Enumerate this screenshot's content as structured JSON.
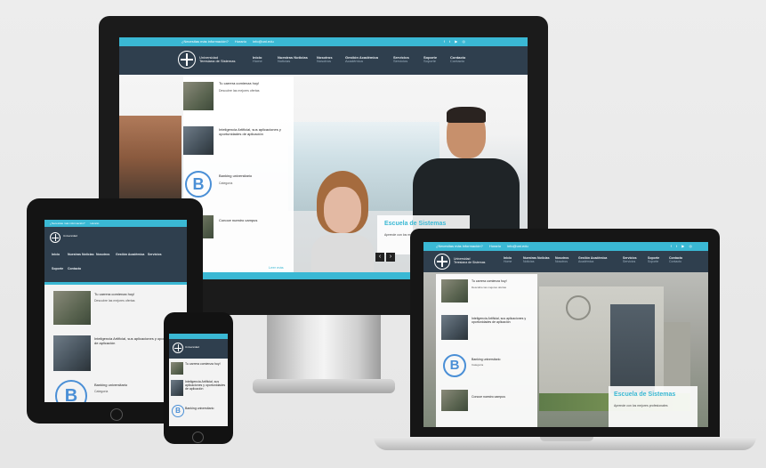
{
  "site": {
    "topbar": {
      "phone": "¿Necesitas más información?",
      "hours": "Horario",
      "email": "info@uni.edu"
    },
    "social_icons": [
      "facebook-icon",
      "twitter-icon",
      "youtube-icon",
      "instagram-icon"
    ],
    "logo_text": {
      "line1": "Universidad",
      "line2": "Teresiana de Sistemas"
    },
    "nav": [
      {
        "label": "Inicio",
        "sub": "Home"
      },
      {
        "label": "Nuestras Noticias",
        "sub": "Noticias"
      },
      {
        "label": "Nosotros",
        "sub": "Nosotros"
      },
      {
        "label": "Gestión Académica",
        "sub": "Académica"
      },
      {
        "label": "Servicios",
        "sub": "Servicios"
      },
      {
        "label": "Soporte",
        "sub": "Soporte"
      },
      {
        "label": "Contacto",
        "sub": "Contacto"
      }
    ],
    "posts": [
      {
        "title": "Tu carrera comienza hoy!",
        "meta": "Descubre las mejores ofertas"
      },
      {
        "title": "Inteligencia Artificial, sus aplicaciones y oportunidades de aplicación",
        "meta": ""
      },
      {
        "title": "Banking universitario",
        "meta": "Categoría"
      },
      {
        "title": "Conoce nuestro campus",
        "meta": ""
      }
    ],
    "hero_card": {
      "title": "Escuela de Sistemas",
      "text": "Aprende con los mejores profesionales"
    },
    "more_label": "Leer más"
  },
  "colors": {
    "accent": "#3ab8d4",
    "nav_bg": "#2f3f4e",
    "badge_blue": "#4a8fd6"
  }
}
